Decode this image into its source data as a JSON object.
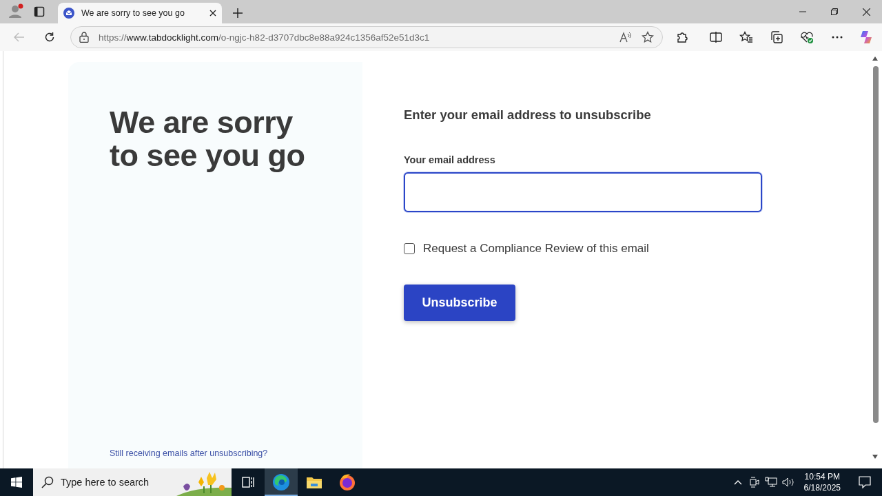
{
  "browser": {
    "tab": {
      "title": "We are sorry to see you go",
      "selected": true
    },
    "address": {
      "scheme": "https://",
      "host": "www.tabdocklight.com",
      "path": "/o-ngjc-h82-d3707dbc8e88a924c1356af52e51d3c1"
    }
  },
  "page": {
    "heading": "We are sorry to see you go",
    "footer_link": "Still receiving emails after unsubscribing?",
    "form_title": "Enter your email address to unsubscribe",
    "email_label": "Your email address",
    "checkbox": {
      "label": "Request a Compliance Review of this email",
      "checked": false
    },
    "button": "Unsubscribe"
  },
  "taskbar": {
    "search_placeholder": "Type here to search",
    "time": "10:54 PM",
    "date": "6/18/2025"
  }
}
